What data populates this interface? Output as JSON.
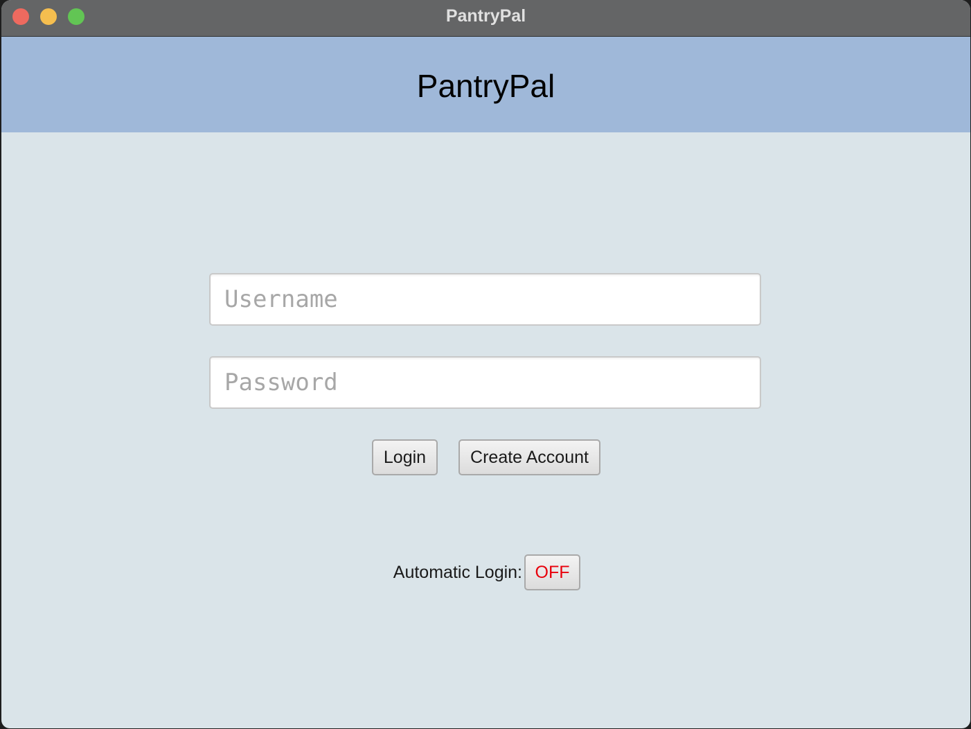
{
  "window": {
    "title": "PantryPal"
  },
  "header": {
    "title": "PantryPal"
  },
  "login_form": {
    "username_placeholder": "Username",
    "password_placeholder": "Password",
    "login_label": "Login",
    "create_account_label": "Create Account"
  },
  "auto_login": {
    "label": "Automatic Login:",
    "state": "OFF",
    "state_color": "#e8000b"
  },
  "colors": {
    "titlebar": "#646566",
    "header_bg": "#9fb8d9",
    "body_bg": "#dae4e9",
    "close": "#ee6a5f",
    "minimize": "#f5be4f",
    "maximize": "#62c554"
  }
}
